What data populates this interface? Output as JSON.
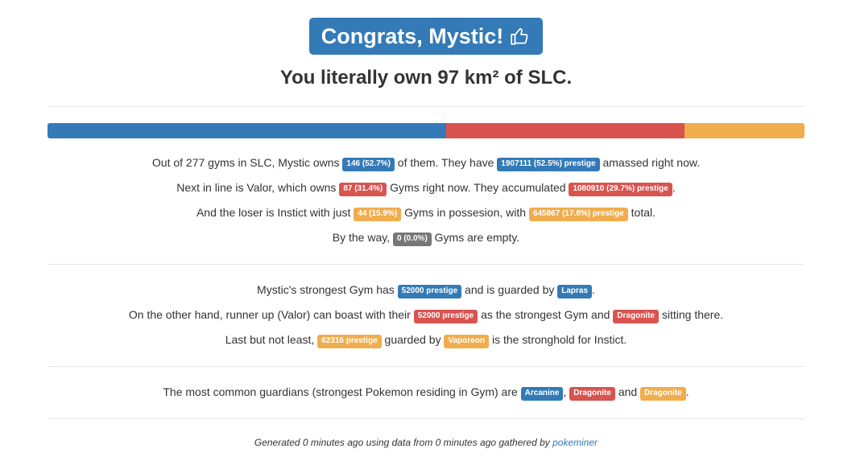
{
  "header": {
    "title": "Congrats, Mystic!",
    "icon": "thumbs-up-icon",
    "subtitle": "You literally own 97 km² of SLC."
  },
  "colors": {
    "mystic": "#337ab7",
    "valor": "#d9534f",
    "instinct": "#f0ad4e",
    "empty": "#777777"
  },
  "ownership_bar": {
    "mystic": 52.7,
    "valor": 31.4,
    "instinct": 15.9
  },
  "stats": {
    "l1": {
      "t1": "Out of 277 gyms in SLC, Mystic owns",
      "b1": "146 (52.7%)",
      "t2": "of them. They have",
      "b2": "1907111 (52.5%) prestige",
      "t3": "amassed right now."
    },
    "l2": {
      "t1": "Next in line is Valor, which owns",
      "b1": "87 (31.4%)",
      "t2": "Gyms right now. They accumulated",
      "b2": "1080910 (29.7%) prestige",
      "t3": "."
    },
    "l3": {
      "t1": "And the loser is Instict with just",
      "b1": "44 (15.9%)",
      "t2": "Gyms in possesion, with",
      "b2": "645867 (17.8%) prestige",
      "t3": "total."
    },
    "l4": {
      "t1": "By the way,",
      "b1": "0 (0.0%)",
      "t2": "Gyms are empty."
    }
  },
  "strongest": {
    "l1": {
      "t1": "Mystic's strongest Gym has",
      "b1": "52000 prestige",
      "t2": "and is guarded by",
      "b2": "Lapras",
      "t3": "."
    },
    "l2": {
      "t1": "On the other hand, runner up (Valor) can boast with their",
      "b1": "52000 prestige",
      "t2": "as the strongest Gym and",
      "b2": "Dragonite",
      "t3": "sitting there."
    },
    "l3": {
      "t1": "Last but not least,",
      "b1": "62316 prestige",
      "t2": "guarded by",
      "b2": "Vaporeon",
      "t3": "is the stronghold for Instict."
    }
  },
  "guardians": {
    "t1": "The most common guardians (strongest Pokemon residing in Gym) are",
    "b1": "Arcanine",
    "t2": ",",
    "b2": "Dragonite",
    "t3": "and",
    "b3": "Dragonite",
    "t4": "."
  },
  "footer": {
    "text": "Generated 0 minutes ago using data from 0 minutes ago gathered by",
    "link": "pokeminer"
  }
}
